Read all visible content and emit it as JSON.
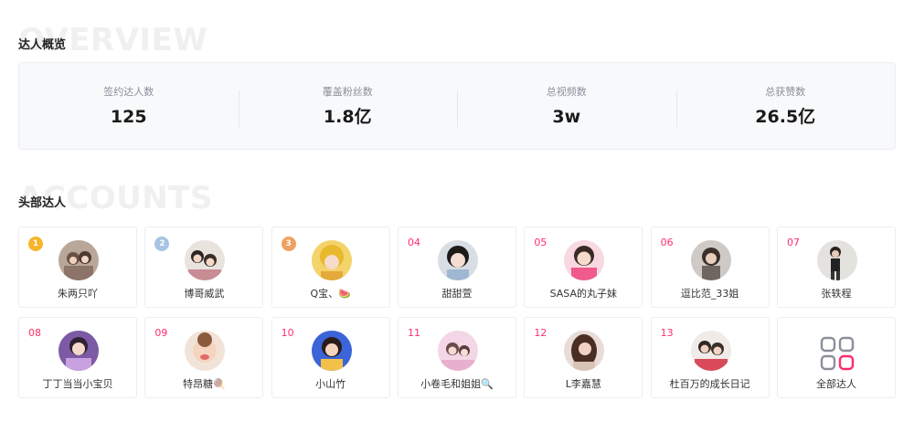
{
  "overview": {
    "watermark": "OVERVIEW",
    "title": "达人概览",
    "stats": [
      {
        "label": "签约达人数",
        "value": "125"
      },
      {
        "label": "覆盖粉丝数",
        "value": "1.8亿"
      },
      {
        "label": "总视频数",
        "value": "3w"
      },
      {
        "label": "总获赞数",
        "value": "26.5亿"
      }
    ]
  },
  "accounts": {
    "watermark": "ACCOUNTS",
    "title": "头部达人",
    "items": [
      {
        "rank": "1",
        "name": "朱两只吖"
      },
      {
        "rank": "2",
        "name": "博哥威武"
      },
      {
        "rank": "3",
        "name": "Q宝、🍉"
      },
      {
        "rank": "04",
        "name": "甜甜萱"
      },
      {
        "rank": "05",
        "name": "SASA的丸子妹"
      },
      {
        "rank": "06",
        "name": "逗比范_33姐"
      },
      {
        "rank": "07",
        "name": "张轶程"
      },
      {
        "rank": "08",
        "name": "丁丁当当小宝贝"
      },
      {
        "rank": "09",
        "name": "特昂糖🍭"
      },
      {
        "rank": "10",
        "name": "小山竹"
      },
      {
        "rank": "11",
        "name": "小卷毛和姐姐🔍"
      },
      {
        "rank": "12",
        "name": "L李嘉慧"
      },
      {
        "rank": "13",
        "name": "杜百万的成长日记"
      }
    ],
    "all_label": "全部达人"
  },
  "colors": {
    "accent": "#ff2d6a",
    "medal_gold": "#f7b52c",
    "medal_silver": "#a9c3e6",
    "medal_bronze": "#f0a060"
  }
}
